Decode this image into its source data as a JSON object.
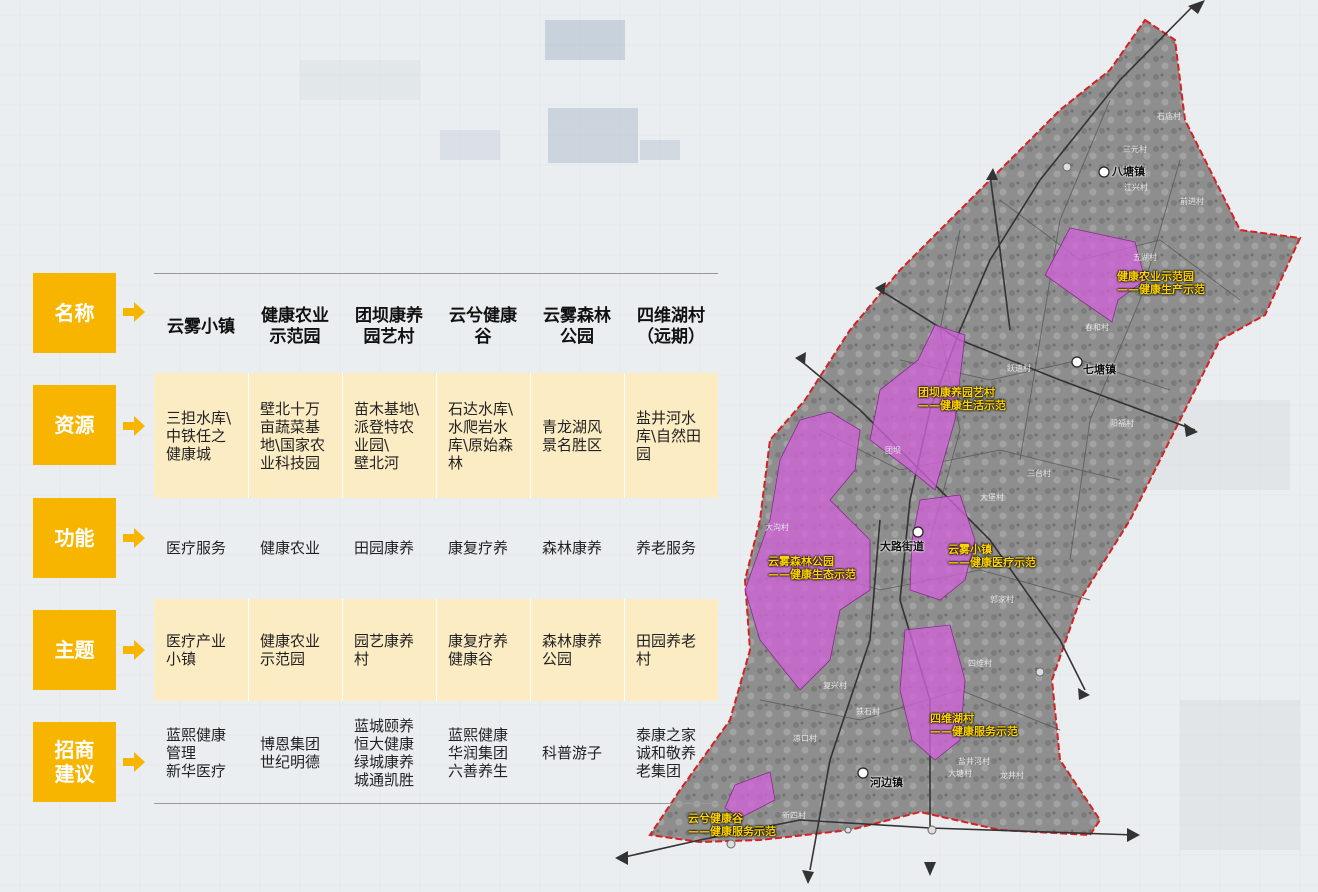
{
  "categories": [
    {
      "id": "name",
      "label": "名称"
    },
    {
      "id": "resource",
      "label": "资源"
    },
    {
      "id": "function",
      "label": "功能"
    },
    {
      "id": "theme",
      "label": "主题"
    },
    {
      "id": "investment",
      "label": "招商\n建议"
    }
  ],
  "columns": [
    {
      "header": "云雾小镇",
      "resource": "三担水库\\\n中铁任之\n健康城",
      "function": "医疗服务",
      "theme": "医疗产业\n小镇",
      "investment": "蓝熙健康\n管理\n新华医疗"
    },
    {
      "header": "健康农业\n示范园",
      "resource": "壁北十万\n亩蔬菜基\n地\\国家农\n业科技园",
      "function": "健康农业",
      "theme": "健康农业\n示范园",
      "investment": "博恩集团\n世纪明德"
    },
    {
      "header": "团坝康养\n园艺村",
      "resource": "苗木基地\\\n派登特农\n业园\\\n壁北河",
      "function": "田园康养",
      "theme": "园艺康养\n村",
      "investment": "蓝城颐养\n恒大健康\n绿城康养\n城通凯胜"
    },
    {
      "header": "云兮健康\n谷",
      "resource": "石达水库\\\n水爬岩水\n库\\原始森\n林",
      "function": "康复疗养",
      "theme": "康复疗养\n健康谷",
      "investment": "蓝熙健康\n华润集团\n六善养生"
    },
    {
      "header": "云雾森林\n公园",
      "resource": "青龙湖风\n景名胜区",
      "function": "森林康养",
      "theme": "森林康养\n公园",
      "investment": "科普游子"
    },
    {
      "header": "四维湖村\n（远期）",
      "resource": "盐井河水\n库\\自然田\n园",
      "function": "养老服务",
      "theme": "田园养老\n村",
      "investment": "泰康之家\n诚和敬养\n老集团"
    }
  ],
  "map": {
    "zones": [
      {
        "name": "健康农业示范园",
        "label": "健康农业示范园\n——健康生产示范"
      },
      {
        "name": "团坝康养园艺村",
        "label": "团坝康养园艺村\n——健康生活示范"
      },
      {
        "name": "云雾森林公园",
        "label": "云雾森林公园\n——健康生态示范"
      },
      {
        "name": "云雾小镇",
        "label": "云雾小镇\n——健康医疗示范"
      },
      {
        "name": "四维湖村",
        "label": "四维湖村\n——健康服务示范"
      },
      {
        "name": "云兮健康谷",
        "label": "云兮健康谷\n——健康服务示范"
      }
    ],
    "towns": [
      "八塘镇",
      "七塘镇",
      "大路街道",
      "河边镇"
    ],
    "villages": [
      "石庙村",
      "三元村",
      "江兴村",
      "前进村",
      "五湖村",
      "春和村",
      "跃进村",
      "三台村",
      "阳福村",
      "大堡村",
      "郭家村",
      "四维村",
      "盐井河村",
      "大塘村",
      "龙井村",
      "复兴村",
      "铁石村",
      "团坝",
      "新四村",
      "凉口村",
      "大沟村"
    ],
    "colors": {
      "zone_fill": "#d064d8",
      "boundary": "#d92020",
      "label_text": "#ffd400",
      "category_bg": "#f7b500",
      "band_bg": "#fcecc4"
    }
  }
}
